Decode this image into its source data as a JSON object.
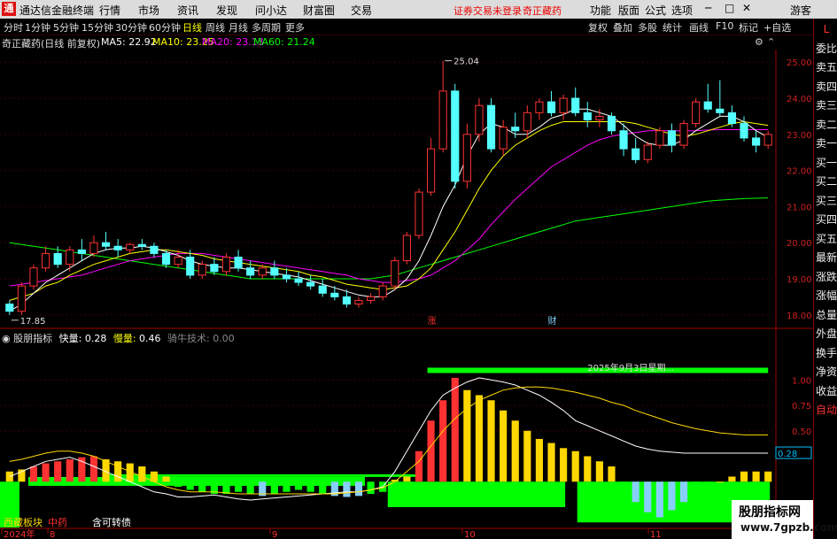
{
  "titlebar": {
    "logo": "通",
    "app_name": "通达信金融终端",
    "menu": [
      "行情",
      "市场",
      "资讯",
      "发现",
      "问小达",
      "财富圈",
      "交易"
    ],
    "login_status": "证券交易未登录",
    "stock_name": "奇正藏药",
    "right_menu": [
      "功能",
      "版面",
      "公式",
      "选项"
    ],
    "guest": "游客",
    "win_controls": [
      "─",
      "□",
      "✕"
    ]
  },
  "period_tabs": {
    "items": [
      "分时",
      "1分钟",
      "5分钟",
      "15分钟",
      "30分钟",
      "60分钟",
      "日线",
      "周线",
      "月线",
      "多周期",
      "更多"
    ],
    "active": "日线"
  },
  "tool_tabs": [
    "复权",
    "叠加",
    "多股",
    "统计",
    "画线",
    "F10",
    "标记",
    "+自选"
  ],
  "info": {
    "stock_title": "奇正藏药(日线 前复权)",
    "ma5": "MA5: 22.92",
    "ma10": "MA10: 23.25",
    "ma20": "MA20: 23.13",
    "ma60": "MA60: 21.24"
  },
  "indicator": {
    "name": "股朋指标",
    "fast_label": "快量:",
    "fast_value": "0.28",
    "slow_label": "慢量:",
    "slow_value": "0.46",
    "extra": "骑牛技术: 0.00",
    "current_label": "0.28",
    "overlay_text": "2025年9月3日星期..."
  },
  "side_panel": [
    "L",
    "委比",
    "卖五",
    "卖四",
    "卖三",
    "卖二",
    "卖一",
    "买一",
    "买二",
    "买三",
    "买四",
    "买五",
    "最新",
    "涨跌",
    "涨幅",
    "总量",
    "外盘",
    "换手",
    "净资",
    "收益",
    "自动"
  ],
  "price_axis": [
    "25.00",
    "24.00",
    "23.00",
    "22.00",
    "21.00",
    "20.00",
    "19.00",
    "18.00"
  ],
  "indicator_axis": [
    "1.00",
    "0.75",
    "0.50"
  ],
  "annotations": {
    "high": "25.04",
    "low": "17.85",
    "zhang": "涨",
    "cai": "财"
  },
  "bottom_tags": {
    "tag1": "西藏板块",
    "tag2": "中药",
    "tag3": "含可转债"
  },
  "date_axis": [
    "2024年",
    "8",
    "9",
    "10",
    "11"
  ],
  "watermark": {
    "line1": "股朋指标网",
    "line2": "www.7gpzb.com"
  },
  "colors": {
    "up": "#ff3232",
    "down": "#54ffff",
    "ma5": "#ffffff",
    "ma10": "#ffff00",
    "ma20": "#ff00ff",
    "ma60": "#00ff00",
    "indicator_green": "#00ff00",
    "indicator_yellow": "#ffd700",
    "indicator_blue": "#87cefa"
  },
  "chart_data": {
    "type": "candlestick",
    "ylim": [
      17.7,
      25.3
    ],
    "candles": [
      [
        18.3,
        18.4,
        18.0,
        18.1
      ],
      [
        18.1,
        18.9,
        18.0,
        18.8
      ],
      [
        18.8,
        19.4,
        18.7,
        19.3
      ],
      [
        19.3,
        19.9,
        19.2,
        19.7
      ],
      [
        19.7,
        19.9,
        19.3,
        19.4
      ],
      [
        19.4,
        19.9,
        19.2,
        19.8
      ],
      [
        19.8,
        20.1,
        19.5,
        19.7
      ],
      [
        19.7,
        20.2,
        19.6,
        20.0
      ],
      [
        20.0,
        20.3,
        19.8,
        19.9
      ],
      [
        19.9,
        20.1,
        19.6,
        19.8
      ],
      [
        19.8,
        20.0,
        19.7,
        19.95
      ],
      [
        19.95,
        20.1,
        19.8,
        19.9
      ],
      [
        19.9,
        20.0,
        19.6,
        19.7
      ],
      [
        19.7,
        19.8,
        19.3,
        19.4
      ],
      [
        19.4,
        19.8,
        19.3,
        19.6
      ],
      [
        19.6,
        19.8,
        19.0,
        19.1
      ],
      [
        19.1,
        19.5,
        19.0,
        19.4
      ],
      [
        19.4,
        19.6,
        19.1,
        19.2
      ],
      [
        19.2,
        19.7,
        19.1,
        19.6
      ],
      [
        19.6,
        19.8,
        19.2,
        19.3
      ],
      [
        19.3,
        19.5,
        19.0,
        19.1
      ],
      [
        19.1,
        19.4,
        19.0,
        19.3
      ],
      [
        19.3,
        19.5,
        19.0,
        19.1
      ],
      [
        19.1,
        19.3,
        18.9,
        19.0
      ],
      [
        19.0,
        19.2,
        18.8,
        18.9
      ],
      [
        18.9,
        19.1,
        18.7,
        18.8
      ],
      [
        18.8,
        19.0,
        18.5,
        18.6
      ],
      [
        18.6,
        18.8,
        18.4,
        18.5
      ],
      [
        18.5,
        18.7,
        18.2,
        18.3
      ],
      [
        18.3,
        18.5,
        18.2,
        18.4
      ],
      [
        18.4,
        18.6,
        18.3,
        18.5
      ],
      [
        18.5,
        18.9,
        18.4,
        18.8
      ],
      [
        18.8,
        19.6,
        18.7,
        19.5
      ],
      [
        19.5,
        20.3,
        19.4,
        20.2
      ],
      [
        20.2,
        21.5,
        20.1,
        21.4
      ],
      [
        21.4,
        22.9,
        21.3,
        22.6
      ],
      [
        22.6,
        25.04,
        22.5,
        24.2
      ],
      [
        24.2,
        24.4,
        21.5,
        21.7
      ],
      [
        21.7,
        23.3,
        21.5,
        23.0
      ],
      [
        23.0,
        24.0,
        22.8,
        23.8
      ],
      [
        23.8,
        24.0,
        22.5,
        22.6
      ],
      [
        22.6,
        23.4,
        22.4,
        23.2
      ],
      [
        23.2,
        23.6,
        22.9,
        23.1
      ],
      [
        23.1,
        23.8,
        22.9,
        23.6
      ],
      [
        23.6,
        24.0,
        23.4,
        23.9
      ],
      [
        23.9,
        24.2,
        23.5,
        23.6
      ],
      [
        23.6,
        24.1,
        23.4,
        24.0
      ],
      [
        24.0,
        24.3,
        23.5,
        23.6
      ],
      [
        23.6,
        23.9,
        23.2,
        23.4
      ],
      [
        23.4,
        23.7,
        23.2,
        23.5
      ],
      [
        23.5,
        23.6,
        23.0,
        23.1
      ],
      [
        23.1,
        23.3,
        22.4,
        22.6
      ],
      [
        22.6,
        22.9,
        22.2,
        22.3
      ],
      [
        22.3,
        22.8,
        22.2,
        22.7
      ],
      [
        22.7,
        23.2,
        22.6,
        23.1
      ],
      [
        23.1,
        23.3,
        22.5,
        22.7
      ],
      [
        22.7,
        23.4,
        22.6,
        23.3
      ],
      [
        23.3,
        24.0,
        23.2,
        23.9
      ],
      [
        23.9,
        24.4,
        23.6,
        23.7
      ],
      [
        23.7,
        24.5,
        23.5,
        23.6
      ],
      [
        23.6,
        23.8,
        23.2,
        23.3
      ],
      [
        23.3,
        23.5,
        22.8,
        22.9
      ],
      [
        22.9,
        23.1,
        22.5,
        22.7
      ],
      [
        22.7,
        23.1,
        22.6,
        23.0
      ]
    ],
    "ma5": [
      18.1,
      18.3,
      18.6,
      18.9,
      19.1,
      19.3,
      19.5,
      19.7,
      19.8,
      19.85,
      19.85,
      19.9,
      19.85,
      19.75,
      19.65,
      19.5,
      19.4,
      19.35,
      19.3,
      19.3,
      19.25,
      19.2,
      19.15,
      19.1,
      19.05,
      18.95,
      18.85,
      18.75,
      18.65,
      18.55,
      18.5,
      18.5,
      18.7,
      19.0,
      19.5,
      20.2,
      21.0,
      21.6,
      22.4,
      23.0,
      23.3,
      23.2,
      23.0,
      23.0,
      23.2,
      23.45,
      23.55,
      23.7,
      23.7,
      23.6,
      23.5,
      23.25,
      22.95,
      22.75,
      22.7,
      22.7,
      22.85,
      23.1,
      23.3,
      23.5,
      23.5,
      23.35,
      23.1,
      22.92
    ],
    "ma10": [
      18.4,
      18.5,
      18.6,
      18.8,
      18.9,
      19.1,
      19.25,
      19.4,
      19.5,
      19.6,
      19.7,
      19.75,
      19.8,
      19.8,
      19.75,
      19.7,
      19.65,
      19.55,
      19.5,
      19.45,
      19.4,
      19.35,
      19.3,
      19.25,
      19.2,
      19.1,
      19.05,
      18.95,
      18.85,
      18.8,
      18.75,
      18.7,
      18.75,
      18.8,
      19.0,
      19.3,
      19.8,
      20.3,
      20.9,
      21.5,
      22.0,
      22.4,
      22.7,
      22.9,
      23.1,
      23.25,
      23.35,
      23.35,
      23.35,
      23.35,
      23.35,
      23.35,
      23.3,
      23.2,
      23.1,
      23.0,
      22.95,
      23.0,
      23.1,
      23.2,
      23.3,
      23.35,
      23.3,
      23.25
    ],
    "ma20": [
      18.8,
      18.85,
      18.9,
      18.95,
      19.0,
      19.05,
      19.1,
      19.2,
      19.3,
      19.4,
      19.5,
      19.55,
      19.6,
      19.65,
      19.7,
      19.7,
      19.7,
      19.65,
      19.6,
      19.55,
      19.5,
      19.45,
      19.4,
      19.35,
      19.3,
      19.25,
      19.2,
      19.15,
      19.1,
      19.0,
      18.95,
      18.9,
      18.9,
      18.95,
      19.0,
      19.1,
      19.3,
      19.5,
      19.8,
      20.1,
      20.5,
      20.85,
      21.2,
      21.5,
      21.8,
      22.1,
      22.3,
      22.5,
      22.7,
      22.85,
      22.95,
      23.0,
      23.05,
      23.1,
      23.1,
      23.1,
      23.1,
      23.1,
      23.12,
      23.13,
      23.13,
      23.13,
      23.13,
      23.13
    ],
    "ma60": [
      20.0,
      19.95,
      19.9,
      19.85,
      19.8,
      19.75,
      19.7,
      19.65,
      19.6,
      19.55,
      19.5,
      19.45,
      19.4,
      19.35,
      19.3,
      19.25,
      19.2,
      19.15,
      19.1,
      19.05,
      19.0,
      19.0,
      19.0,
      19.0,
      19.0,
      19.0,
      19.0,
      19.0,
      19.0,
      19.0,
      19.0,
      19.05,
      19.1,
      19.2,
      19.3,
      19.4,
      19.5,
      19.6,
      19.7,
      19.8,
      19.9,
      20.0,
      20.1,
      20.2,
      20.3,
      20.4,
      20.5,
      20.6,
      20.65,
      20.7,
      20.75,
      20.8,
      20.85,
      20.9,
      20.95,
      21.0,
      21.05,
      21.1,
      21.15,
      21.18,
      21.2,
      21.22,
      21.23,
      21.24
    ],
    "indicator_bars": [
      0.1,
      0.12,
      0.15,
      0.18,
      0.2,
      0.22,
      0.24,
      0.25,
      0.22,
      0.2,
      0.18,
      0.15,
      0.1,
      0.05,
      -0.05,
      -0.08,
      -0.1,
      -0.12,
      -0.12,
      -0.1,
      -0.12,
      -0.14,
      -0.12,
      -0.1,
      -0.08,
      -0.1,
      -0.12,
      -0.14,
      -0.15,
      -0.14,
      -0.12,
      -0.1,
      0.02,
      0.05,
      0.3,
      0.6,
      0.8,
      1.02,
      0.9,
      0.85,
      0.8,
      0.7,
      0.6,
      0.5,
      0.42,
      0.38,
      0.33,
      0.3,
      0.25,
      0.2,
      0.15,
      -0.1,
      -0.2,
      -0.3,
      -0.35,
      -0.28,
      -0.2,
      -0.1,
      -0.05,
      0.0,
      0.05,
      0.1,
      0.1,
      0.1
    ],
    "fast_line": [
      0.05,
      0.1,
      0.15,
      0.2,
      0.22,
      0.24,
      0.2,
      0.15,
      0.1,
      0.05,
      0.0,
      -0.05,
      -0.1,
      -0.12,
      -0.15,
      -0.15,
      -0.14,
      -0.13,
      -0.15,
      -0.17,
      -0.18,
      -0.17,
      -0.16,
      -0.15,
      -0.14,
      -0.13,
      -0.12,
      -0.11,
      -0.1,
      -0.1,
      -0.08,
      -0.05,
      0.1,
      0.3,
      0.5,
      0.7,
      0.85,
      0.92,
      0.98,
      1.02,
      1.0,
      0.98,
      0.95,
      0.9,
      0.85,
      0.78,
      0.7,
      0.6,
      0.55,
      0.5,
      0.45,
      0.4,
      0.35,
      0.32,
      0.3,
      0.29,
      0.28,
      0.28,
      0.28,
      0.28,
      0.28,
      0.28,
      0.28,
      0.28
    ],
    "slow_line": [
      0.2,
      0.22,
      0.25,
      0.28,
      0.3,
      0.3,
      0.28,
      0.25,
      0.2,
      0.15,
      0.1,
      0.05,
      0.0,
      -0.05,
      -0.08,
      -0.1,
      -0.1,
      -0.1,
      -0.11,
      -0.12,
      -0.12,
      -0.12,
      -0.12,
      -0.12,
      -0.12,
      -0.12,
      -0.12,
      -0.12,
      -0.11,
      -0.1,
      -0.08,
      -0.06,
      0.0,
      0.1,
      0.2,
      0.35,
      0.5,
      0.62,
      0.72,
      0.8,
      0.85,
      0.9,
      0.92,
      0.93,
      0.93,
      0.92,
      0.9,
      0.88,
      0.85,
      0.82,
      0.78,
      0.75,
      0.7,
      0.66,
      0.62,
      0.58,
      0.55,
      0.52,
      0.5,
      0.48,
      0.47,
      0.46,
      0.46,
      0.46
    ]
  }
}
